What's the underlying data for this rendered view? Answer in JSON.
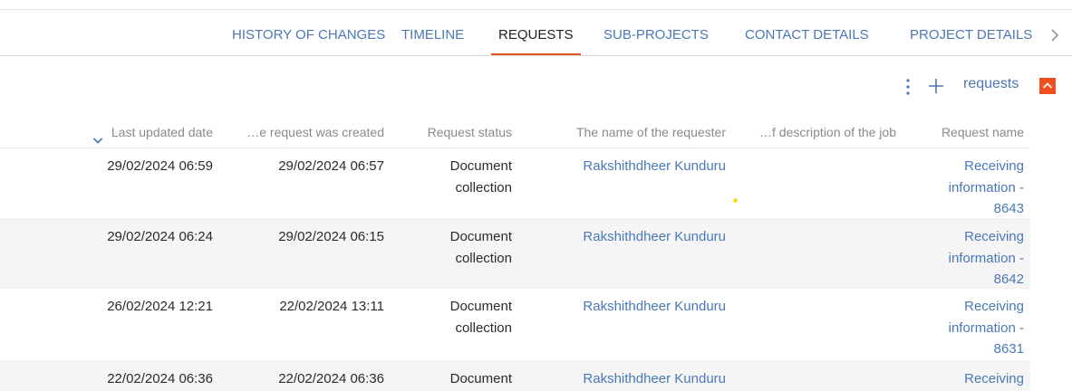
{
  "tabs": [
    {
      "label": "HISTORY OF CHANGES",
      "active": false
    },
    {
      "label": "TIMELINE",
      "active": false
    },
    {
      "label": "REQUESTS",
      "active": true
    },
    {
      "label": "SUB-PROJECTS",
      "active": false
    },
    {
      "label": "CONTACT DETAILS",
      "active": false
    },
    {
      "label": "PROJECT DETAILS",
      "active": false
    }
  ],
  "toolbar": {
    "title": "requests",
    "icons": [
      "more-vertical-icon",
      "plus-icon",
      "chevron-up-icon"
    ]
  },
  "table": {
    "columns": [
      "Last updated date",
      "…e request was created",
      "Request status",
      "The name of the requester",
      "…f description of the job",
      "Request name"
    ],
    "sorted_column": "Last updated date",
    "rows": [
      {
        "updated": "29/02/2024 06:59",
        "created": "29/02/2024 06:57",
        "status": [
          "Document",
          "collection"
        ],
        "requester": "Rakshithdheer Kunduru",
        "description": "",
        "name": [
          "Receiving",
          "information -",
          "8643"
        ]
      },
      {
        "updated": "29/02/2024 06:24",
        "created": "29/02/2024 06:15",
        "status": [
          "Document",
          "collection"
        ],
        "requester": "Rakshithdheer Kunduru",
        "description": "",
        "name": [
          "Receiving",
          "information -",
          "8642"
        ]
      },
      {
        "updated": "26/02/2024 12:21",
        "created": "22/02/2024 13:11",
        "status": [
          "Document",
          "collection"
        ],
        "requester": "Rakshithdheer Kunduru",
        "description": "",
        "name": [
          "Receiving",
          "information -",
          "8631"
        ]
      },
      {
        "updated": "22/02/2024 06:36",
        "created": "22/02/2024 06:36",
        "status": [
          "Document"
        ],
        "requester": "Rakshithdheer Kunduru",
        "description": "",
        "name": [
          "Receiving"
        ]
      }
    ]
  },
  "colors": {
    "link": "#4a78b8",
    "accent": "#e8521f",
    "collapse_button": "#f04e1e",
    "row_alt": "#f5f5f5"
  }
}
